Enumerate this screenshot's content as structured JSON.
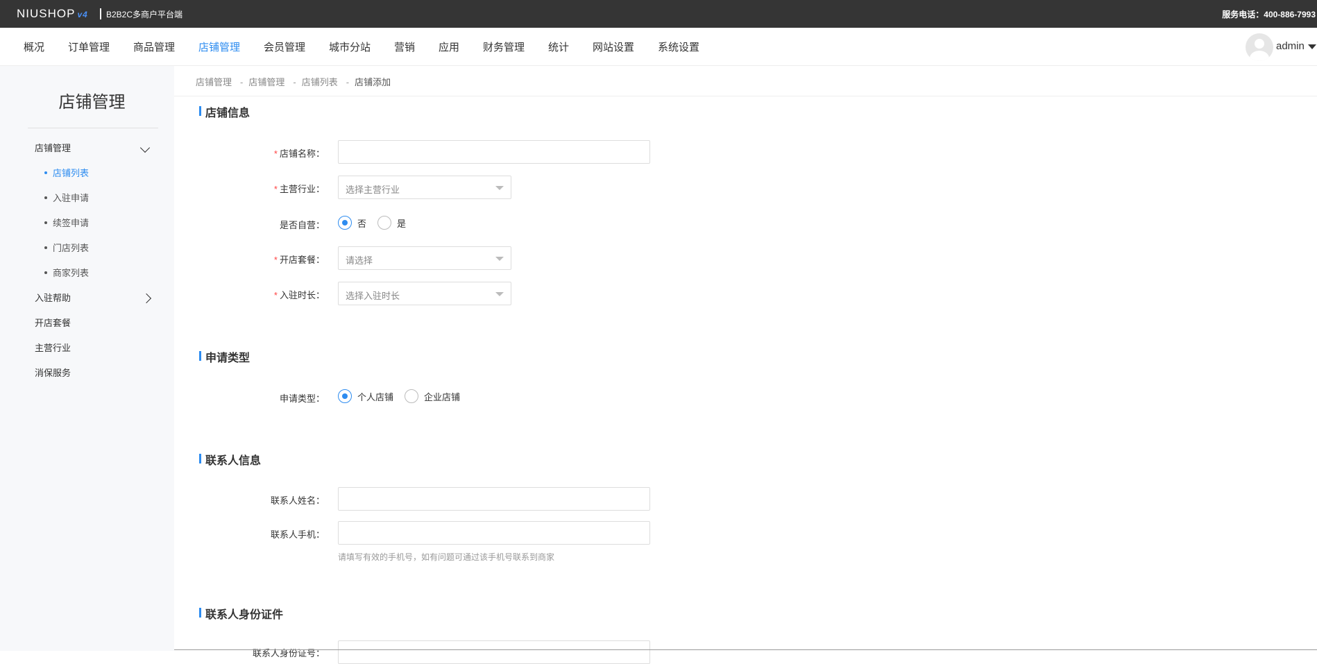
{
  "topbar": {
    "logo": "NIUSHOP",
    "logo_version": "v4",
    "platform": "B2B2C多商户平台端",
    "service_phone": "服务电话：400-886-7993"
  },
  "nav": {
    "items": [
      "概况",
      "订单管理",
      "商品管理",
      "店铺管理",
      "会员管理",
      "城市分站",
      "营销",
      "应用",
      "财务管理",
      "统计",
      "网站设置",
      "系统设置"
    ],
    "active": "店铺管理",
    "user": "admin"
  },
  "sidebar": {
    "title": "店铺管理",
    "group1": "店铺管理",
    "subitems": [
      "店铺列表",
      "入驻申请",
      "续签申请",
      "门店列表",
      "商家列表"
    ],
    "active_sub": "店铺列表",
    "items": [
      "入驻帮助",
      "开店套餐",
      "主营行业",
      "消保服务"
    ]
  },
  "breadcrumb": [
    "店铺管理",
    "店铺管理",
    "店铺列表",
    "店铺添加"
  ],
  "sections": {
    "shop_info": {
      "title": "店铺信息",
      "name_label": "店铺名称：",
      "name_value": "",
      "industry_label": "主营行业：",
      "industry_placeholder": "选择主营行业",
      "self_label": "是否自营：",
      "self_options": [
        "否",
        "是"
      ],
      "package_label": "开店套餐：",
      "package_placeholder": "请选择",
      "duration_label": "入驻时长：",
      "duration_placeholder": "选择入驻时长"
    },
    "apply_type": {
      "title": "申请类型",
      "label": "申请类型：",
      "options": [
        "个人店铺",
        "企业店铺"
      ]
    },
    "contact": {
      "title": "联系人信息",
      "name_label": "联系人姓名：",
      "phone_label": "联系人手机：",
      "phone_hint": "请填写有效的手机号，如有问题可通过该手机号联系到商家"
    },
    "id_card": {
      "title": "联系人身份证件",
      "id_label": "联系人身份证号："
    }
  },
  "colors": {
    "topbar": "#353535",
    "accent": "#2d8cf0",
    "sidebar_bg": "#f7f8fa",
    "required": "#f44444"
  }
}
